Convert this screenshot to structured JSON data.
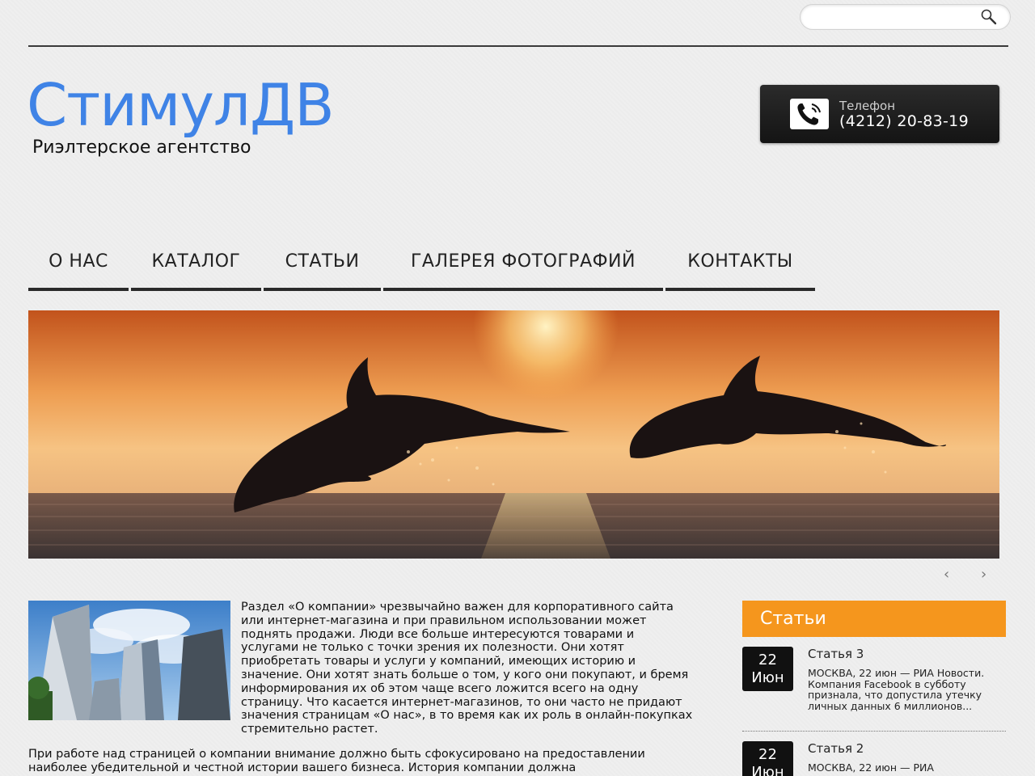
{
  "search": {
    "placeholder": "",
    "value": ""
  },
  "header": {
    "logo_title": "СтимулДВ",
    "logo_subtitle": "Риэлтерское агентство",
    "phone_label": "Телефон",
    "phone_number": "(4212) 20-83-19"
  },
  "nav": {
    "items": [
      {
        "label": "О НАС"
      },
      {
        "label": "КАТАЛОГ"
      },
      {
        "label": "СТАТЬИ"
      },
      {
        "label": "ГАЛЕРЕЯ ФОТОГРАФИЙ"
      },
      {
        "label": "КОНТАКТЫ"
      }
    ]
  },
  "slider": {
    "prev": "‹",
    "next": "›"
  },
  "about": {
    "paragraph1": "Раздел «О компании» чрезвычайно важен для корпоративного сайта или интернет-магазина и при правильном использовании может поднять продажи. Люди все больше интересуются товарами и услугами не только с точки зрения их полезности. Они хотят приобретать товары и услуги у компаний, имеющих историю и значение. Они хотят знать больше о том, у кого они покупают, и бремя информирования их об этом чаще всего ложится всего на одну страницу. Что касается интернет-магазинов, то они часто не придают значения страницам «О нас», в то время как их роль в онлайн-покупках стремительно растет.",
    "paragraph2": "При работе над страницей о компании внимание должно быть сфокусировано на предоставлении наиболее убедительной и честной истории вашего бизнеса. История компании должна"
  },
  "sidebar": {
    "title": "Статьи",
    "articles": [
      {
        "day": "22",
        "month": "Июн",
        "title": "Статья 3",
        "excerpt": "МОСКВА, 22 июн — РИА Новости. Компания Facebook в субботу признала, что допустила утечку личных данных 6 миллионов..."
      },
      {
        "day": "22",
        "month": "Июн",
        "title": "Статья 2",
        "excerpt": "МОСКВА, 22 июн — РИА"
      }
    ]
  }
}
